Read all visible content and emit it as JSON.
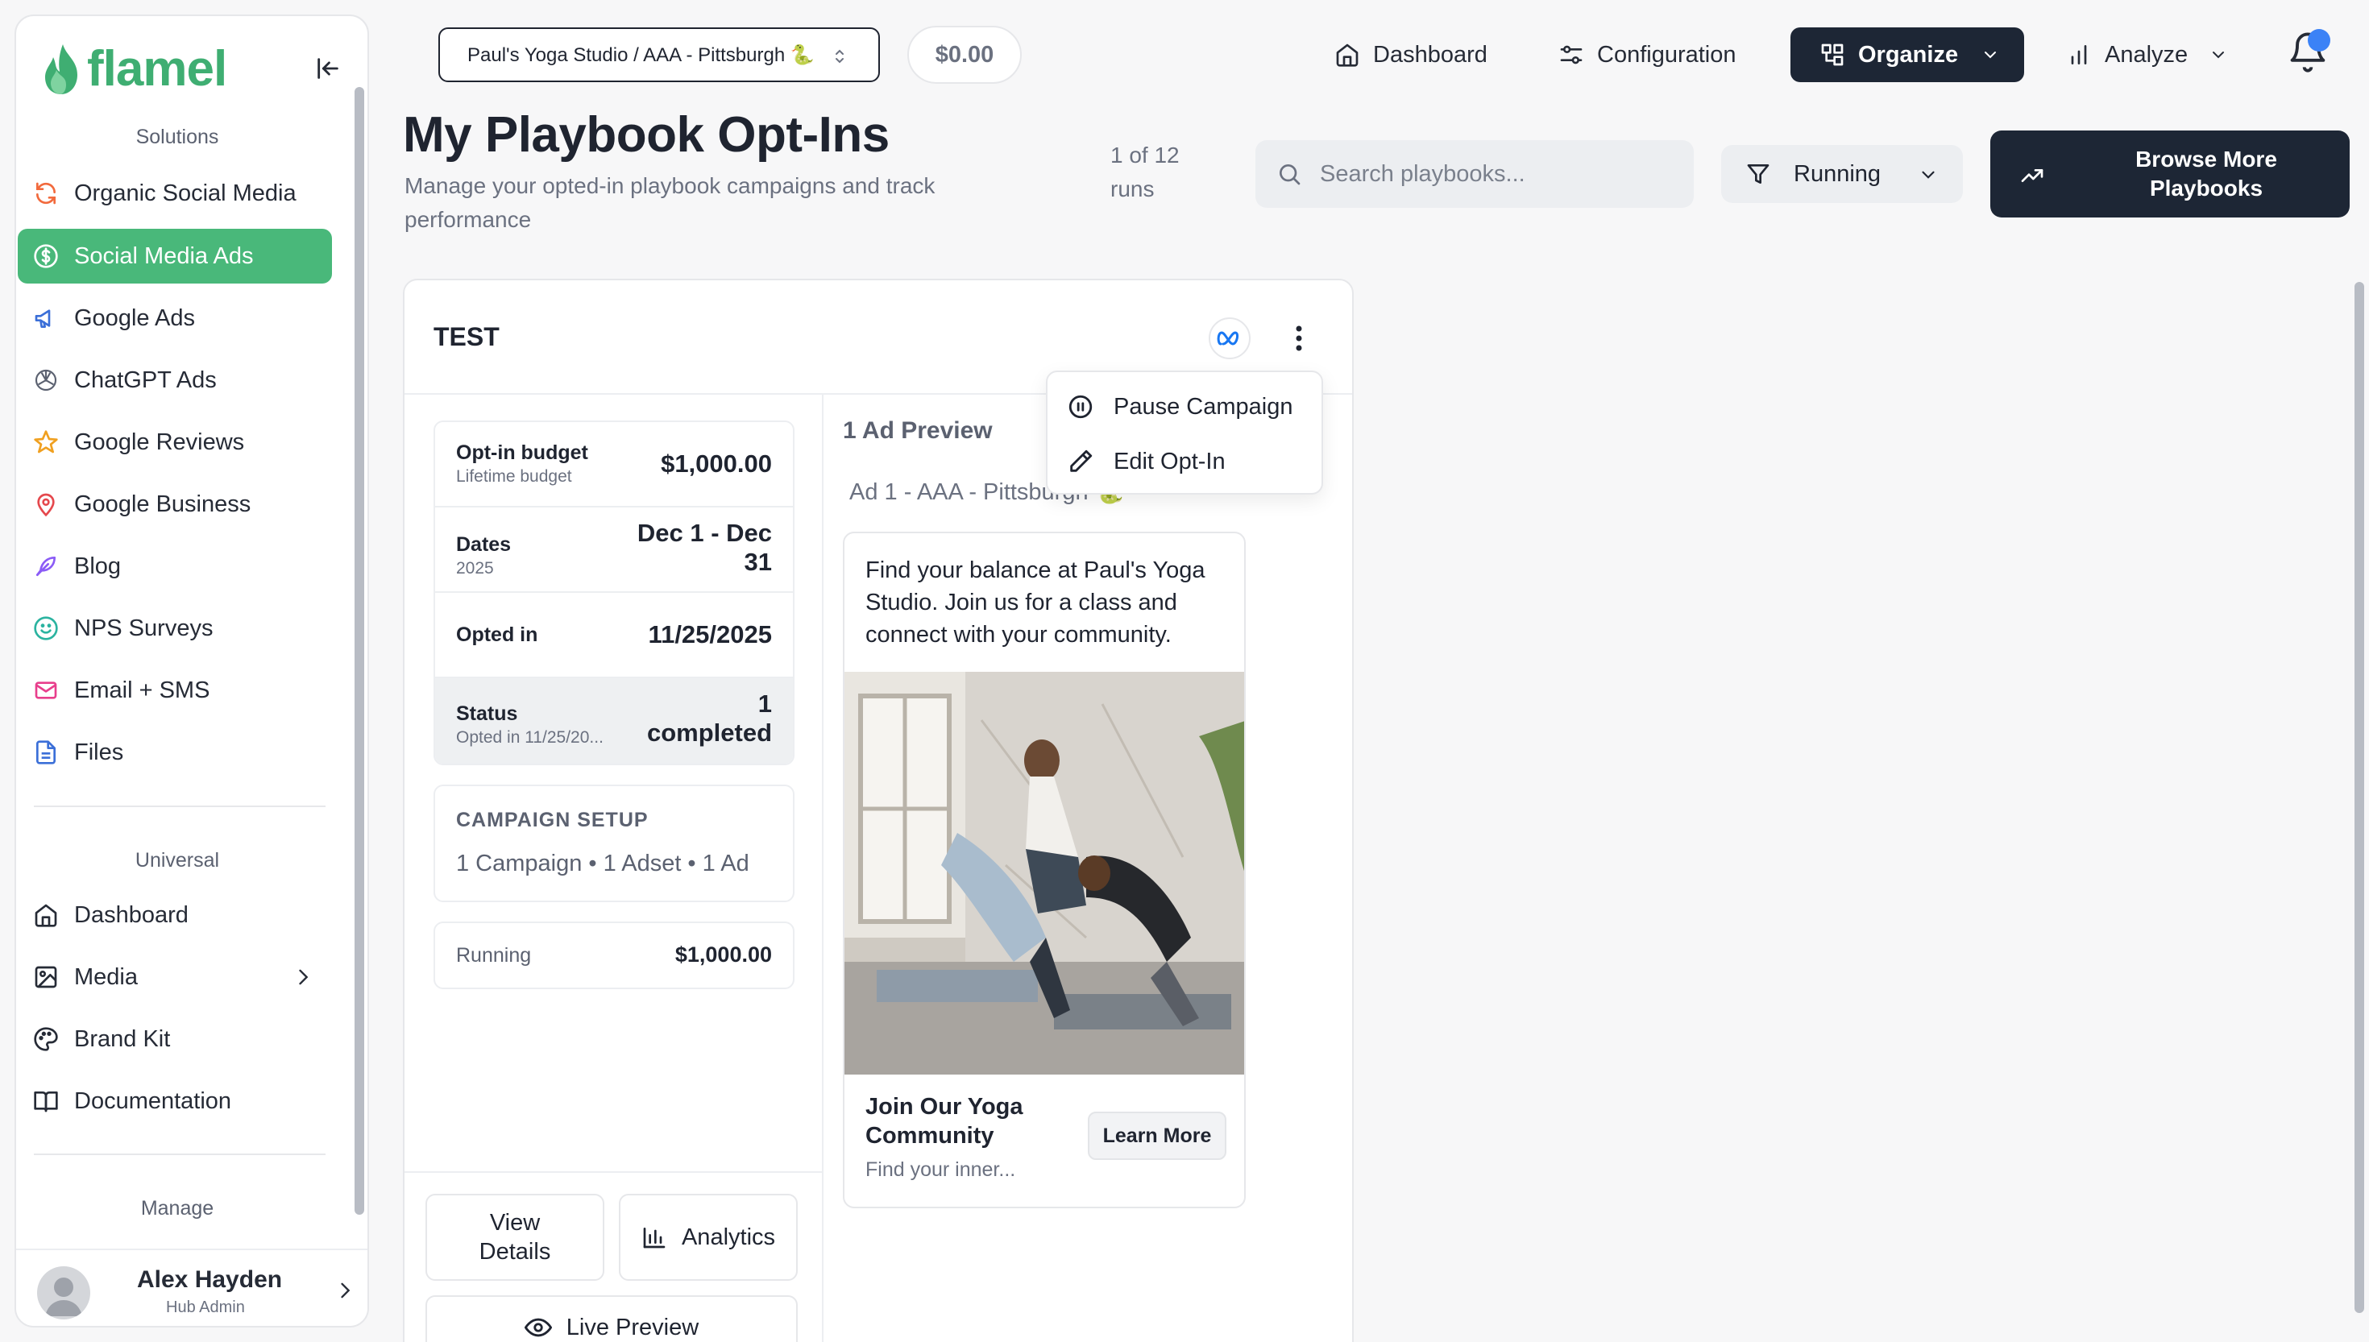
{
  "brand": {
    "name": "flamel",
    "color": "#3fae72"
  },
  "sidebar": {
    "sections": {
      "solutions": "Solutions",
      "universal": "Universal",
      "manage": "Manage"
    },
    "solutions_items": [
      {
        "label": "Organic Social Media",
        "icon": "refresh-icon"
      },
      {
        "label": "Social Media Ads",
        "icon": "dollar-icon",
        "active": true
      },
      {
        "label": "Google Ads",
        "icon": "megaphone-icon"
      },
      {
        "label": "ChatGPT Ads",
        "icon": "openai-icon"
      },
      {
        "label": "Google Reviews",
        "icon": "star-icon"
      },
      {
        "label": "Google Business",
        "icon": "map-pin-icon"
      },
      {
        "label": "Blog",
        "icon": "feather-icon"
      },
      {
        "label": "NPS Surveys",
        "icon": "smile-icon"
      },
      {
        "label": "Email + SMS",
        "icon": "mail-icon"
      },
      {
        "label": "Files",
        "icon": "file-icon"
      }
    ],
    "universal_items": [
      {
        "label": "Dashboard",
        "icon": "home-icon"
      },
      {
        "label": "Media",
        "icon": "image-icon"
      },
      {
        "label": "Brand Kit",
        "icon": "palette-icon"
      },
      {
        "label": "Documentation",
        "icon": "book-icon"
      }
    ],
    "user": {
      "name": "Alex Hayden",
      "role": "Hub Admin"
    }
  },
  "topbar": {
    "store_select": "Paul's Yoga Studio / AAA - Pittsburgh 🐍",
    "balance": "$0.00",
    "nav": {
      "dashboard": "Dashboard",
      "configuration": "Configuration",
      "organize": "Organize",
      "analyze": "Analyze"
    }
  },
  "page": {
    "title": "My Playbook Opt-Ins",
    "subtitle": "Manage your opted-in playbook campaigns and track performance",
    "runs": "1 of 12 runs",
    "search_placeholder": "Search playbooks...",
    "filter": "Running",
    "browse_button": "Browse More Playbooks"
  },
  "card": {
    "title": "TEST",
    "info": {
      "budget_label": "Opt-in budget",
      "budget_sub": "Lifetime budget",
      "budget_value": "$1,000.00",
      "dates_label": "Dates",
      "dates_sub": "2025",
      "dates_value_1": "Dec 1 - Dec",
      "dates_value_2": "31",
      "opted_label": "Opted in",
      "opted_value": "11/25/2025",
      "status_label": "Status",
      "status_sub": "Opted in 11/25/20...",
      "status_value_1": "1",
      "status_value_2": "completed"
    },
    "setup": {
      "label": "CAMPAIGN SETUP",
      "value": "1 Campaign • 1 Adset • 1 Ad"
    },
    "running": {
      "label": "Running",
      "value": "$1,000.00"
    },
    "buttons": {
      "view_details_1": "View",
      "view_details_2": "Details",
      "analytics": "Analytics",
      "live_preview": "Live Preview"
    },
    "preview": {
      "label": "1 Ad Preview",
      "ad_label": "Ad 1 - AAA - Pittsburgh 🐍",
      "copy": "Find your balance at Paul's Yoga Studio. Join us for a class and connect with your community.",
      "headline": "Join Our Yoga Community",
      "description": "Find your inner...",
      "cta": "Learn More"
    },
    "menu": {
      "pause": "Pause Campaign",
      "edit": "Edit Opt-In"
    }
  }
}
